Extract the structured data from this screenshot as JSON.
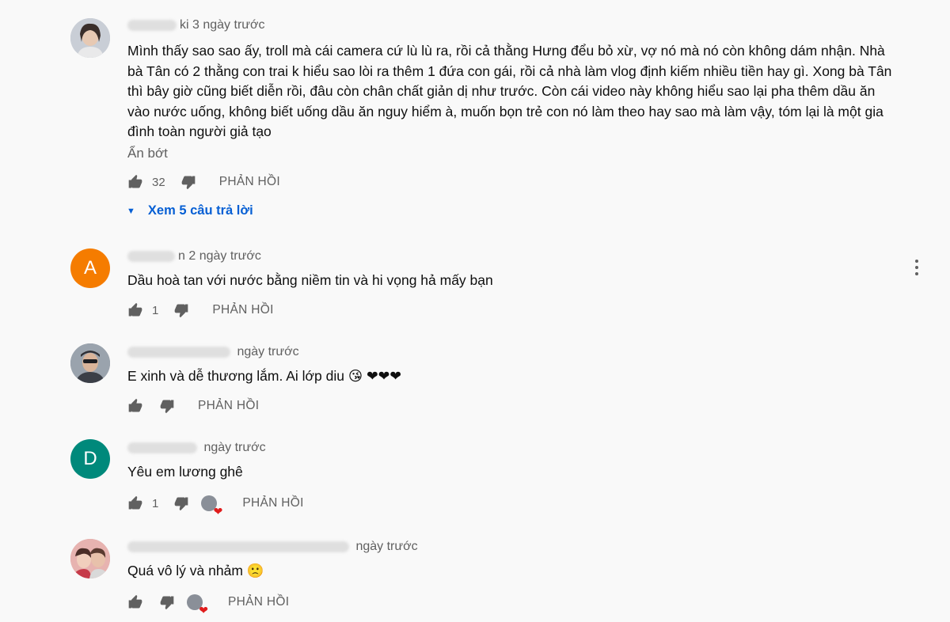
{
  "comments": [
    {
      "avatar_color": "#b9bec7",
      "author_suffix": "ki",
      "time": "3 ngày trước",
      "text": "Mình thấy sao sao ấy, troll mà cái camera cứ lù lù ra, rồi cả thằng Hưng đểu bỏ xừ, vợ nó mà nó còn không dám nhận. Nhà bà Tân có 2 thằng con trai k hiểu sao lòi ra thêm 1 đứa con gái, rồi cả nhà làm vlog định kiếm nhiều tiền hay gì. Xong bà Tân thì bây giờ cũng biết diễn rồi, đâu còn chân chất giản dị như trước. Còn cái video này không hiểu sao lại pha thêm dầu ăn vào nước uống, không biết uống dầu ăn nguy hiểm à, muốn bọn trẻ con nó làm theo hay sao mà làm vậy, tóm lại là một gia đình toàn người giả tạo",
      "show_less": "Ẩn bớt",
      "likes": "32",
      "reply": "PHẢN HỒI",
      "view_replies": "Xem 5 câu trả lời"
    },
    {
      "avatar_letter": "A",
      "avatar_color": "#f57c00",
      "author_suffix": "n",
      "time": "2 ngày trước",
      "text": "Dầu hoà tan với nước bằng niềm tin và hi vọng hả mấy bạn",
      "likes": "1",
      "reply": "PHẢN HỒI"
    },
    {
      "avatar_color": "#7d8794",
      "author_suffix": "",
      "time": "ngày trước",
      "text": "E xinh và dễ thương lắm. Ai lớp diu 😘 ❤❤❤",
      "likes": "",
      "reply": "PHẢN HỒI"
    },
    {
      "avatar_letter": "D",
      "avatar_color": "#00897b",
      "author_suffix": "",
      "time": "ngày trước",
      "text": "Yêu em lương ghê",
      "likes": "1",
      "reply": "PHẢN HỒI",
      "heart_icon": "❤"
    },
    {
      "avatar_color": "#d99a9a",
      "author_suffix": "",
      "time": "ngày trước",
      "text": "Quá vô lý và nhảm 🙁",
      "likes": "",
      "reply": "PHẢN HỒI",
      "heart_icon": "❤"
    }
  ],
  "colors": {
    "link": "#065fd4",
    "secondary": "#606060",
    "background": "#f9f9f9"
  },
  "icons": {
    "like": "thumb-up-icon",
    "dislike": "thumb-down-icon",
    "more": "more-vert-icon",
    "expand": "caret-down-icon"
  }
}
